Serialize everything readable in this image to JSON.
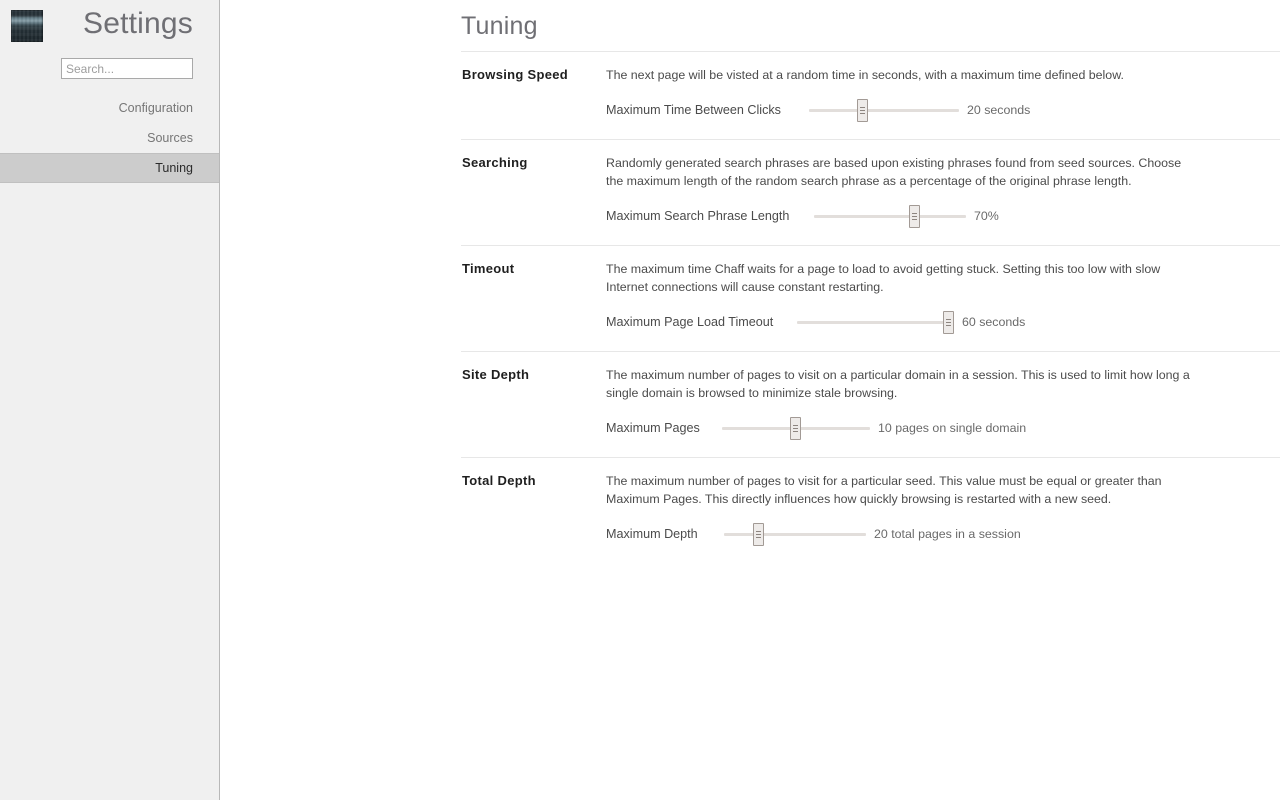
{
  "sidebar": {
    "app_icon_name": "app-icon",
    "title": "Settings",
    "search": {
      "placeholder": "Search...",
      "value": ""
    },
    "items": [
      {
        "label": "Configuration",
        "selected": false
      },
      {
        "label": "Sources",
        "selected": false
      },
      {
        "label": "Tuning",
        "selected": true
      }
    ],
    "background_color": "#f0f0f0",
    "selected_color": "#cccccc"
  },
  "main": {
    "page_title": "Tuning",
    "sections": [
      {
        "label": "Browsing Speed",
        "description": "The next page will be visted at a random time in seconds, with a maximum time defined below.",
        "control": {
          "label": "Maximum Time Between Clicks",
          "value_text": "20 seconds",
          "value": 20,
          "percent": 35
        }
      },
      {
        "label": "Searching",
        "description": "Randomly generated search phrases are based upon existing phrases found from seed sources. Choose the maximum length of the random search phrase as a percentage of the original phrase length.",
        "control": {
          "label": "Maximum Search Phrase Length",
          "value_text": "70%",
          "value": 70,
          "percent": 66
        }
      },
      {
        "label": "Timeout",
        "description": "The maximum time Chaff waits for a page to load to avoid getting stuck. Setting this too low with slow Internet connections will cause constant restarting.",
        "control": {
          "label": "Maximum Page Load Timeout",
          "value_text": "60 seconds",
          "value": 60,
          "percent": 96
        }
      },
      {
        "label": "Site Depth",
        "description": "The maximum number of pages to visit on a particular domain in a session. This is used to limit how long a single domain is browsed to minimize stale browsing.",
        "control": {
          "label": "Maximum Pages",
          "value_text": "10 pages on single domain",
          "value": 10,
          "percent": 49
        }
      },
      {
        "label": "Total Depth",
        "description": "The maximum number of pages to visit for a particular seed. This value must be equal or greater than Maximum Pages. This directly influences how quickly browsing is restarted with a new seed.",
        "control": {
          "label": "Maximum Depth",
          "value_text": "20 total pages in a session",
          "value": 20,
          "percent": 24
        }
      }
    ]
  },
  "colors": {
    "track": "#e2dedb",
    "handle_fill": "#eeebe9",
    "handle_border": "#a29a95",
    "title_text": "#6f6f74",
    "body_text": "#4b4b4b",
    "divider": "#e7e7e7"
  }
}
